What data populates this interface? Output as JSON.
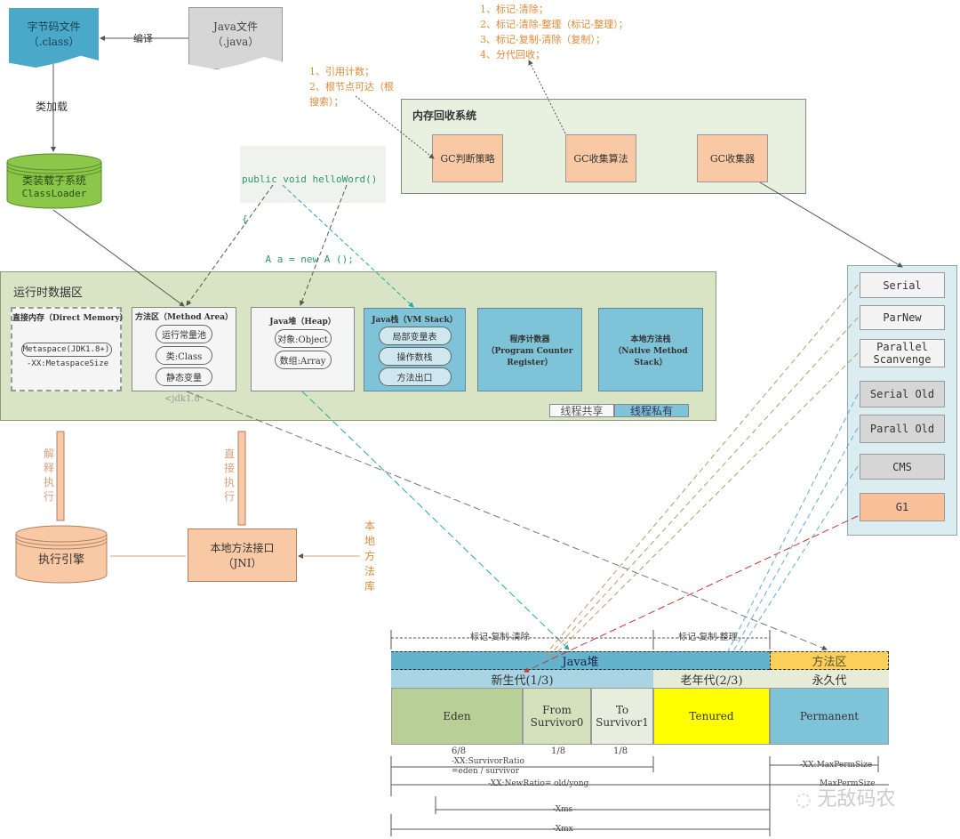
{
  "top": {
    "class_file": {
      "line1": "字节码文件",
      "line2": "（.class）"
    },
    "java_file": {
      "line1": "Java文件",
      "line2": "（.java）"
    },
    "compile_label": "编译",
    "load_label": "类加载",
    "classloader": {
      "line1": "类装载子系统",
      "line2": "ClassLoader"
    }
  },
  "gc_strategy_note": [
    "1、引用计数；",
    "2、根节点可达（根",
    "搜索）；"
  ],
  "gc_algorithm_note": [
    "1、标记-清除；",
    "2、标记-清除-整理（标记-整理）；",
    "3、标记-复制-清除（复制）；",
    "4、分代回收；"
  ],
  "code": {
    "lines": [
      "public void helloWord()",
      "{",
      "    A a = new A ();",
      "}"
    ]
  },
  "gc_system": {
    "title": "内存回收系统",
    "boxes": [
      "GC判断策略",
      "GC收集算法",
      "GC收集器"
    ]
  },
  "runtime": {
    "title": "运行时数据区",
    "direct_memory": {
      "title": "直接内存（Direct Memory）",
      "pill": "Metaspace(JDK1.8+)",
      "note": "-XX:MetaspaceSize"
    },
    "method_area": {
      "title": "方法区（Method Area）",
      "items": [
        "运行常量池",
        "类:Class",
        "静态变量"
      ],
      "note": "<jdk1.8"
    },
    "heap": {
      "title": "Java堆（Heap）",
      "items": [
        "对象:Object",
        "数组:Array"
      ]
    },
    "vm_stack": {
      "title": "Java栈（VM Stack）",
      "items": [
        "局部变量表",
        "操作数栈",
        "方法出口"
      ]
    },
    "pc": {
      "line1": "程序计数器",
      "line2": "（Program Counter",
      "line3": "Register）"
    },
    "native_stack": {
      "line1": "本地方法栈",
      "line2": "（Native Method",
      "line3": "Stack）"
    },
    "legend": {
      "shared": "线程共享",
      "private": "线程私有"
    }
  },
  "collectors": [
    "Serial",
    "ParNew",
    "Parallel Scanvenge",
    "Serial Old",
    "Parall Old",
    "CMS",
    "G1"
  ],
  "execution": {
    "interpret_label": "解释执行",
    "direct_label": "直接执行",
    "engine": "执行引擎",
    "jni": {
      "line1": "本地方法接口",
      "line2": "（JNI）"
    },
    "native_lib": "本地方法库"
  },
  "heap_layout": {
    "young_algo": "标记-复制-清除",
    "old_algo": "标记-复制-整理",
    "java_heap": "Java堆",
    "method_area": "方法区",
    "young": "新生代(1/3)",
    "old": "老年代(2/3)",
    "perm_gen": "永久代",
    "eden": "Eden",
    "from": {
      "line1": "From",
      "line2": "Survivor0"
    },
    "to": {
      "line1": "To",
      "line2": "Survivor1"
    },
    "tenured": "Tenured",
    "permanent": "Permanent",
    "ratios": [
      "6/8",
      "1/8",
      "1/8"
    ],
    "survivor_ratio": {
      "line1": "-XX:SurvivorRatio",
      "line2": "=eden / survivor"
    },
    "new_ratio": "-XX:NewRatio= old/yong",
    "max_perm_size": "-XX:MaxPermSize",
    "max_perm_size2": "MaxPermSize",
    "xms": "-Xms",
    "xmx": "-Xmx"
  },
  "watermark": "无敌码农"
}
